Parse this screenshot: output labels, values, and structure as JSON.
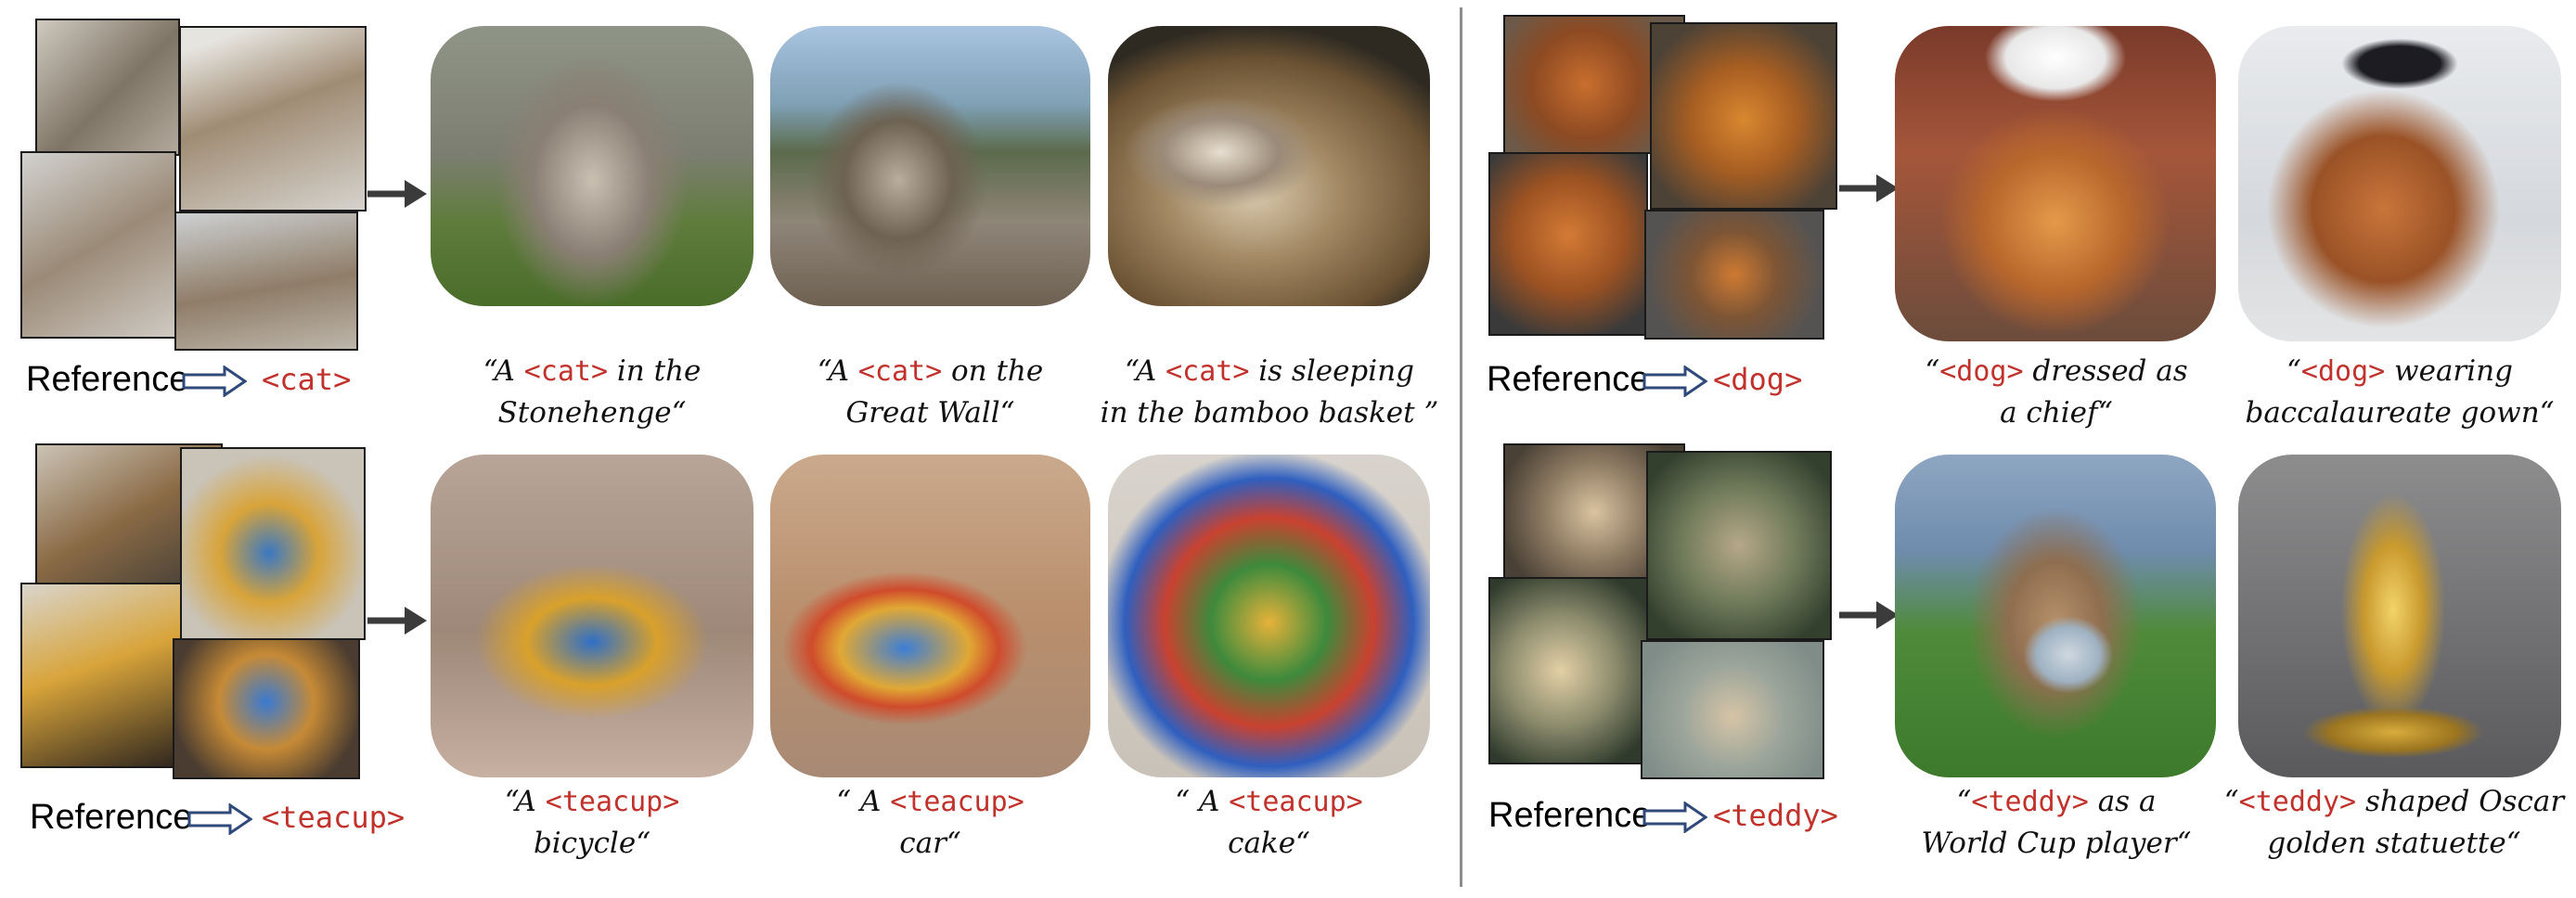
{
  "panels": [
    {
      "reference_label": "Reference",
      "token": "<cat>",
      "captions": [
        {
          "open": "“A ",
          "token": "<cat>",
          "line1_rest": " in the",
          "line2": "Stonehenge“"
        },
        {
          "open": "“A ",
          "token": "<cat>",
          "line1_rest": " on the",
          "line2": "Great Wall“"
        },
        {
          "open": "“A ",
          "token": "<cat>",
          "line1_rest": " is sleeping",
          "line2": "in the bamboo basket ”"
        }
      ]
    },
    {
      "reference_label": "Reference",
      "token": "<teacup>",
      "captions": [
        {
          "open": "“A ",
          "token": "<teacup>",
          "line1_rest": "",
          "line2": "bicycle“"
        },
        {
          "open": "“ A ",
          "token": "<teacup>",
          "line1_rest": "",
          "line2": "car“"
        },
        {
          "open": "“ A ",
          "token": "<teacup>",
          "line1_rest": "",
          "line2": "cake“"
        }
      ]
    },
    {
      "reference_label": "Reference",
      "token": "<dog>",
      "captions": [
        {
          "open": "“",
          "token": "<dog>",
          "line1_rest": " dressed as",
          "line2": "a chief“"
        },
        {
          "open": "“",
          "token": "<dog>",
          "line1_rest": " wearing",
          "line2": "baccalaureate gown“"
        }
      ]
    },
    {
      "reference_label": "Reference",
      "token": "<teddy>",
      "captions": [
        {
          "open": "“",
          "token": "<teddy>",
          "line1_rest": " as a",
          "line2": "World Cup player“"
        },
        {
          "open": "“",
          "token": "<teddy>",
          "line1_rest": " shaped Oscar",
          "line2": "golden statuette“"
        }
      ]
    }
  ],
  "colors": {
    "token": "#c0322b",
    "arrow": "#3b3b3b",
    "hollow_arrow": "#2f4a7a",
    "divider": "#8d8d8d"
  }
}
